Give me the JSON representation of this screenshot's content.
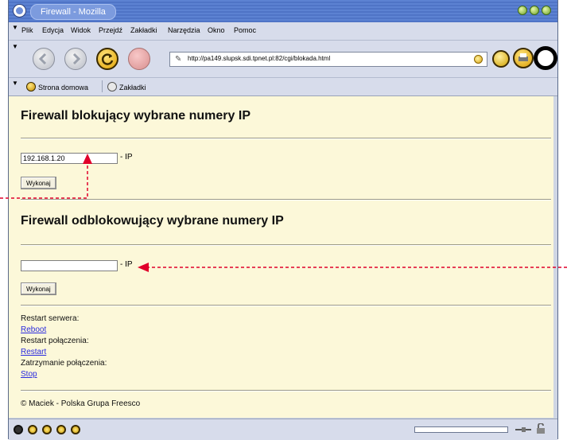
{
  "window": {
    "title": "Firewall - Mozilla"
  },
  "menu": {
    "items": [
      "Plik",
      "Edycja",
      "Widok",
      "Przejdź",
      "Zakładki",
      "Narzędzia",
      "Okno",
      "Pomoc"
    ]
  },
  "navigation": {
    "url": "http://pa149.slupsk.sdi.tpnet.pl:82/cgi/blokada.html",
    "icons": [
      "back-icon",
      "forward-icon",
      "reload-icon",
      "stop-icon",
      "url-page-icon",
      "go-icon",
      "search-icon",
      "print-icon",
      "throbber-icon"
    ]
  },
  "personal_toolbar": {
    "home_label": "Strona domowa",
    "bookmarks_label": "Zakładki"
  },
  "page": {
    "block_section": {
      "heading": "Firewall blokujący wybrane numery IP",
      "ip_value": "192.168.1.20",
      "ip_suffix": "- IP",
      "submit_label": "Wykonaj"
    },
    "unblock_section": {
      "heading": "Firewall odblokowujący wybrane numery IP",
      "ip_value": "",
      "ip_suffix": "- IP",
      "submit_label": "Wykonaj"
    },
    "controls": {
      "server_restart_label": "Restart serwera:",
      "server_restart_link": "Reboot",
      "connection_restart_label": "Restart połączenia:",
      "connection_restart_link": "Restart",
      "connection_stop_label": "Zatrzymanie połączenia:",
      "connection_stop_link": "Stop"
    },
    "footer": "© Maciek - Polska Grupa Freesco"
  },
  "colors": {
    "page_background": "#fcf8d9",
    "titlebar": "#5577cc",
    "chrome": "#d7dceb",
    "link": "#2a2adf",
    "annotation_arrow": "#e0002a"
  }
}
